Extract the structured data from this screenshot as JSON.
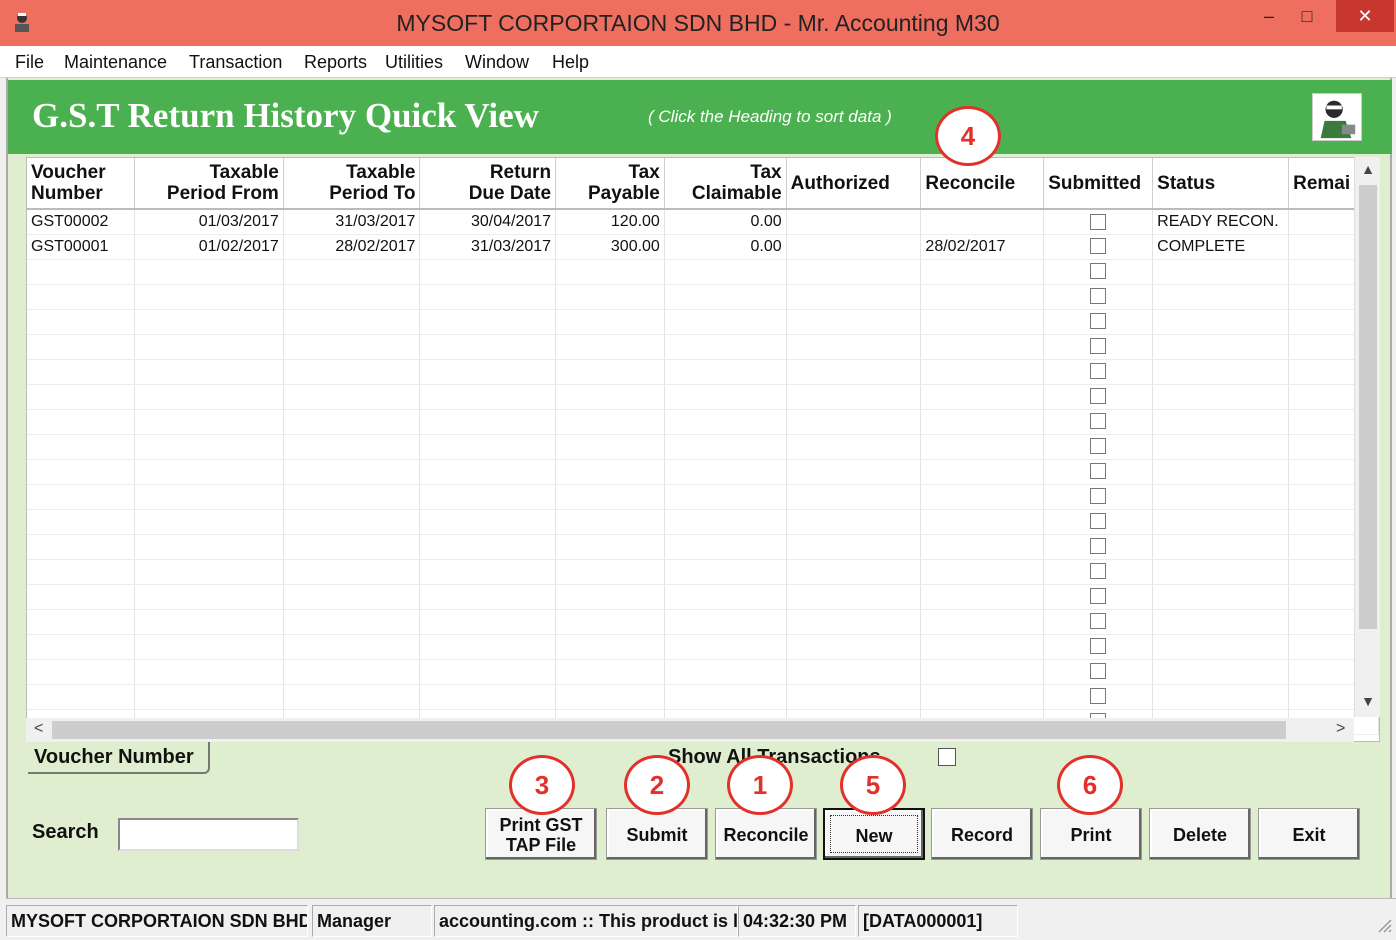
{
  "window": {
    "title": "MYSOFT CORPORTAION SDN BHD - Mr. Accounting M30",
    "minimize": "–",
    "maximize": "□",
    "close": "✕"
  },
  "menu": [
    "File",
    "Maintenance",
    "Transaction",
    "Reports",
    "Utilities",
    "Window",
    "Help"
  ],
  "header": {
    "title": "G.S.T Return History Quick View",
    "hint": "( Click the Heading to sort data )"
  },
  "grid": {
    "columns": [
      {
        "line1": "Voucher",
        "line2": "Number"
      },
      {
        "line1": "Taxable",
        "line2": "Period From"
      },
      {
        "line1": "Taxable",
        "line2": "Period To"
      },
      {
        "line1": "Return",
        "line2": "Due Date"
      },
      {
        "line1": "Tax",
        "line2": "Payable"
      },
      {
        "line1": "Tax",
        "line2": "Claimable"
      },
      {
        "line1": "Authorized",
        "line2": ""
      },
      {
        "line1": "Reconcile",
        "line2": ""
      },
      {
        "line1": "Submitted",
        "line2": ""
      },
      {
        "line1": "Status",
        "line2": ""
      },
      {
        "line1": "Remai",
        "line2": ""
      }
    ],
    "rows": [
      [
        "GST00002",
        "01/03/2017",
        "31/03/2017",
        "30/04/2017",
        "120.00",
        "0.00",
        "",
        "",
        "",
        "READY RECON.",
        ""
      ],
      [
        "GST00001",
        "01/02/2017",
        "28/02/2017",
        "31/03/2017",
        "300.00",
        "0.00",
        "",
        "28/02/2017",
        "",
        "COMPLETE",
        ""
      ]
    ],
    "empty_rows": 19
  },
  "scroll": {
    "left": "<",
    "right": ">",
    "up": "^",
    "down": "v"
  },
  "bottom": {
    "tab_label": "Voucher Number",
    "show_all_label": "Show All Transactions",
    "search_label": "Search",
    "search_value": ""
  },
  "buttons": {
    "print_gst_line1": "Print GST",
    "print_gst_line2": "TAP File",
    "submit": "Submit",
    "reconcile": "Reconcile",
    "new": "New",
    "record": "Record",
    "print": "Print",
    "delete": "Delete",
    "exit": "Exit"
  },
  "callouts": {
    "c1": "1",
    "c2": "2",
    "c3": "3",
    "c4": "4",
    "c5": "5",
    "c6": "6"
  },
  "status": {
    "company": "MYSOFT CORPORTAION SDN BHD",
    "user": "Manager",
    "info": "accounting.com  :: This product is li",
    "time": "04:32:30 PM",
    "data": "[DATA000001]"
  },
  "colors": {
    "titlebar": "#ee6f60",
    "header_green": "#4bb04f",
    "panel": "#dfeecf",
    "callout_red": "#e2312b"
  }
}
